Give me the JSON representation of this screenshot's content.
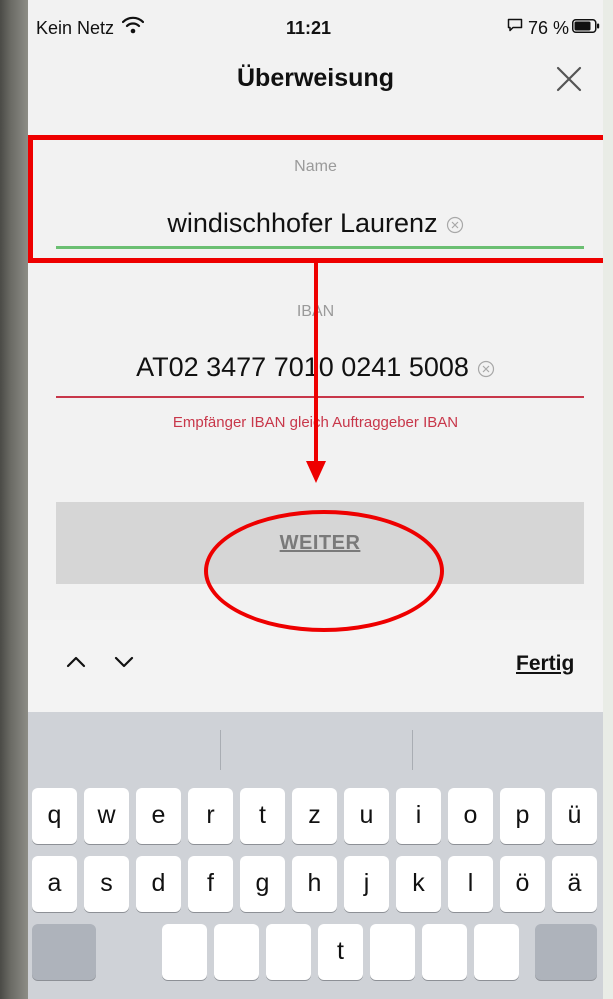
{
  "status_bar": {
    "carrier": "Kein Netz",
    "time": "11:21",
    "battery": "76 %"
  },
  "header": {
    "title": "Überweisung",
    "close_icon": "close-icon"
  },
  "form": {
    "name": {
      "label": "Name",
      "value": "windischhofer Laurenz"
    },
    "iban": {
      "label": "IBAN",
      "value": "AT02 3477 7010 0241 5008",
      "error": "Empfänger IBAN gleich Auftraggeber IBAN"
    },
    "weiter_label": "WEITER"
  },
  "keyboard": {
    "done_label": "Fertig",
    "row1": [
      "q",
      "w",
      "e",
      "r",
      "t",
      "z",
      "u",
      "i",
      "o",
      "p",
      "ü"
    ],
    "row2": [
      "a",
      "s",
      "d",
      "f",
      "g",
      "h",
      "j",
      "k",
      "l",
      "ö",
      "ä"
    ],
    "row3_visible": [
      "t"
    ]
  },
  "colors": {
    "accent_red": "#c8374a",
    "valid_green": "#6bbf72",
    "annotation_red": "#ee0000"
  }
}
